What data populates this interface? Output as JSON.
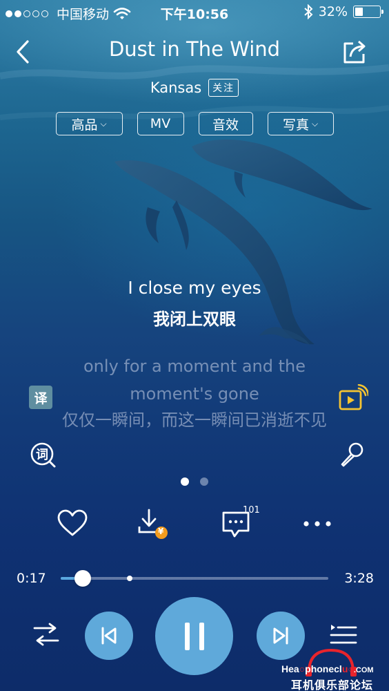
{
  "status_bar": {
    "signal_dots_filled": 2,
    "signal_dots_total": 5,
    "carrier": "中国移动",
    "time": "下午10:56",
    "battery_percent": "32%"
  },
  "header": {
    "song_title": "Dust in The Wind",
    "artist": "Kansas",
    "follow_label": "关注"
  },
  "option_pills": [
    {
      "label": "高品",
      "has_dropdown": true
    },
    {
      "label": "MV",
      "has_dropdown": false
    },
    {
      "label": "音效",
      "has_dropdown": false
    },
    {
      "label": "写真",
      "has_dropdown": true
    }
  ],
  "lyrics": {
    "current_en": "I close my eyes",
    "current_zh": "我闭上双眼",
    "next_en": "only for a moment and the moment's gone",
    "next_zh": "仅仅一瞬间，而这一瞬间已消逝不见"
  },
  "side_buttons": {
    "translate_label": "译",
    "word_label": "词"
  },
  "pager": {
    "pages": 2,
    "active": 0
  },
  "actions": {
    "comment_count": "101",
    "download_badge": "¥"
  },
  "progress": {
    "elapsed": "0:17",
    "total": "3:28",
    "played_fraction": 0.082,
    "buffered_fraction": 0.258
  },
  "watermark": {
    "brand_pre": "Hea",
    "brand_mid": "phonecl",
    "brand_post": ".COM",
    "brand_cn": "耳机俱乐部论坛"
  },
  "colors": {
    "accent": "#5fa9da",
    "progress_played": "#5aa7df",
    "video_icon": "#f5c431",
    "download_badge": "#f39c1e",
    "watermark_red": "#e8242c"
  }
}
